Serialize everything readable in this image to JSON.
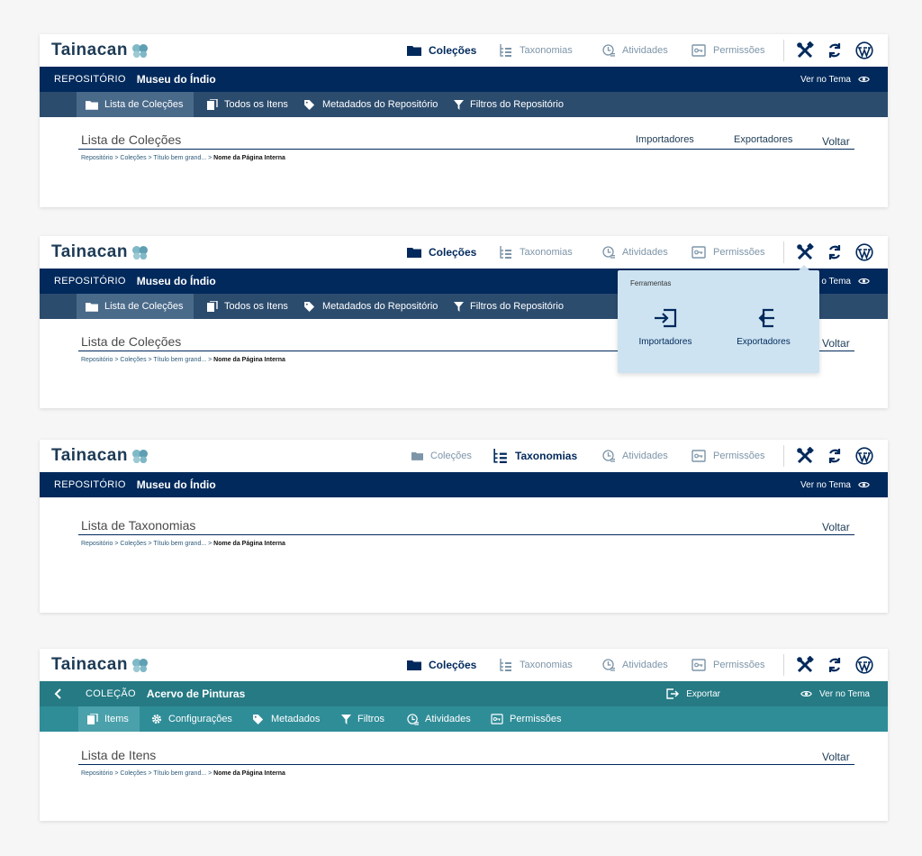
{
  "brand": {
    "logo_text": "Tainacan"
  },
  "colors": {
    "repo_dark": "#01295c",
    "repo_sub": "#2c4c6e",
    "repo_sub_active": "#4a6a8a",
    "collection": "#257a84",
    "collection_sub": "#2f8d98",
    "collection_sub_active": "#4ba1ab",
    "dropdown_bg": "#cde3f1"
  },
  "nav": {
    "colecoes": "Coleções",
    "taxonomias": "Taxonomias",
    "atividades": "Atividades",
    "permissoes": "Permissões"
  },
  "tools": {
    "tools_icon": "tools-icon",
    "sync_icon": "sync-icon",
    "wordpress_icon": "wordpress-icon"
  },
  "repo": {
    "label": "REPOSITÓRIO",
    "name": "Museu do Índio",
    "view_theme": "Ver no Tema",
    "view_theme_cut": "o Tema",
    "subnav": [
      "Lista de Coleções",
      "Todos os Itens",
      "Metadados do Repositório",
      "Filtros do Repositório"
    ]
  },
  "collection": {
    "label": "COLEÇÃO",
    "name": "Acervo de Pinturas",
    "export": "Exportar",
    "view_theme": "Ver no Tema",
    "subnav": [
      "Items",
      "Configurações",
      "Metadados",
      "Filtros",
      "Atividades",
      "Permissões"
    ]
  },
  "panels": [
    {
      "title": "Lista de Coleções",
      "importers": "Importadores",
      "exporters": "Exportadores",
      "back": "Voltar"
    },
    {
      "title": "Lista de Coleções",
      "back": "Voltar"
    },
    {
      "title": "Lista de Taxonomias",
      "back": "Voltar"
    },
    {
      "title": "Lista de Itens",
      "back": "Voltar"
    }
  ],
  "breadcrumb": {
    "path": "Repositório > Coleções > Título bem grand... >",
    "current": "Nome da Página Interna"
  },
  "tools_menu": {
    "header": "Ferramentas",
    "importers": "Importadores",
    "exporters": "Exportadores"
  }
}
